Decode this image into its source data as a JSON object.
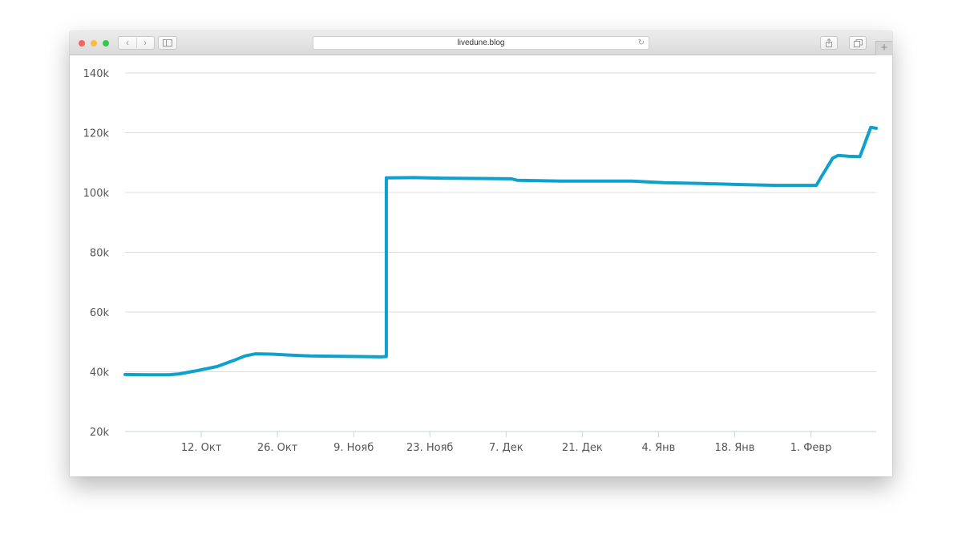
{
  "browser": {
    "url": "livedune.blog",
    "icons": {
      "back": "chevron-left-icon",
      "forward": "chevron-right-icon",
      "sidebar": "sidebar-icon",
      "reload": "reload-icon",
      "share": "share-icon",
      "tabs": "tabs-icon",
      "new_tab": "plus-icon"
    },
    "glyphs": {
      "back": "‹",
      "forward": "›",
      "reload": "↻",
      "new_tab": "+"
    }
  },
  "chart_data": {
    "type": "line",
    "title": "",
    "xlabel": "",
    "ylabel": "",
    "y_ticks": [
      20000,
      40000,
      60000,
      80000,
      100000,
      120000,
      140000
    ],
    "y_tick_labels": [
      "20k",
      "40k",
      "60k",
      "80k",
      "100k",
      "120k",
      "140k"
    ],
    "ylim": [
      20000,
      140000
    ],
    "xlim": [
      "2018-09-28",
      "2019-02-13"
    ],
    "x_ticks": [
      "2018-10-12",
      "2018-10-26",
      "2018-11-09",
      "2018-11-23",
      "2018-12-07",
      "2018-12-21",
      "2019-01-04",
      "2019-01-18",
      "2019-02-01"
    ],
    "x_tick_labels": [
      "12. Окт",
      "26. Окт",
      "9. Нояб",
      "23. Нояб",
      "7. Дек",
      "21. Дек",
      "4. Янв",
      "18. Янв",
      "1. Февр"
    ],
    "grid": "horizontal",
    "colors": {
      "line": "#0fa0cc",
      "grid": "#dcdcdc",
      "axis": "#c8d3e0",
      "tick_label": "#555555"
    },
    "series": [
      {
        "values": [
          [
            "2018-09-28",
            39100
          ],
          [
            "2018-10-02",
            39000
          ],
          [
            "2018-10-06",
            39000
          ],
          [
            "2018-10-08",
            39300
          ],
          [
            "2018-10-11",
            40300
          ],
          [
            "2018-10-15",
            41800
          ],
          [
            "2018-10-18",
            43800
          ],
          [
            "2018-10-20",
            45300
          ],
          [
            "2018-10-22",
            46000
          ],
          [
            "2018-10-25",
            45900
          ],
          [
            "2018-10-28",
            45600
          ],
          [
            "2018-11-01",
            45300
          ],
          [
            "2018-11-05",
            45200
          ],
          [
            "2018-11-10",
            45100
          ],
          [
            "2018-11-14",
            45000
          ],
          [
            "2018-11-15",
            45100
          ],
          [
            "2018-11-15",
            104900
          ],
          [
            "2018-11-20",
            105000
          ],
          [
            "2018-11-25",
            104800
          ],
          [
            "2018-12-02",
            104700
          ],
          [
            "2018-12-08",
            104600
          ],
          [
            "2018-12-09",
            104100
          ],
          [
            "2018-12-17",
            103800
          ],
          [
            "2018-12-24",
            103800
          ],
          [
            "2018-12-30",
            103800
          ],
          [
            "2019-01-05",
            103300
          ],
          [
            "2019-01-12",
            103000
          ],
          [
            "2019-01-20",
            102600
          ],
          [
            "2019-01-26",
            102400
          ],
          [
            "2019-02-02",
            102400
          ],
          [
            "2019-02-03",
            105500
          ],
          [
            "2019-02-05",
            111500
          ],
          [
            "2019-02-06",
            112400
          ],
          [
            "2019-02-08",
            112100
          ],
          [
            "2019-02-10",
            112000
          ],
          [
            "2019-02-12",
            121800
          ],
          [
            "2019-02-13",
            121500
          ]
        ]
      }
    ]
  }
}
